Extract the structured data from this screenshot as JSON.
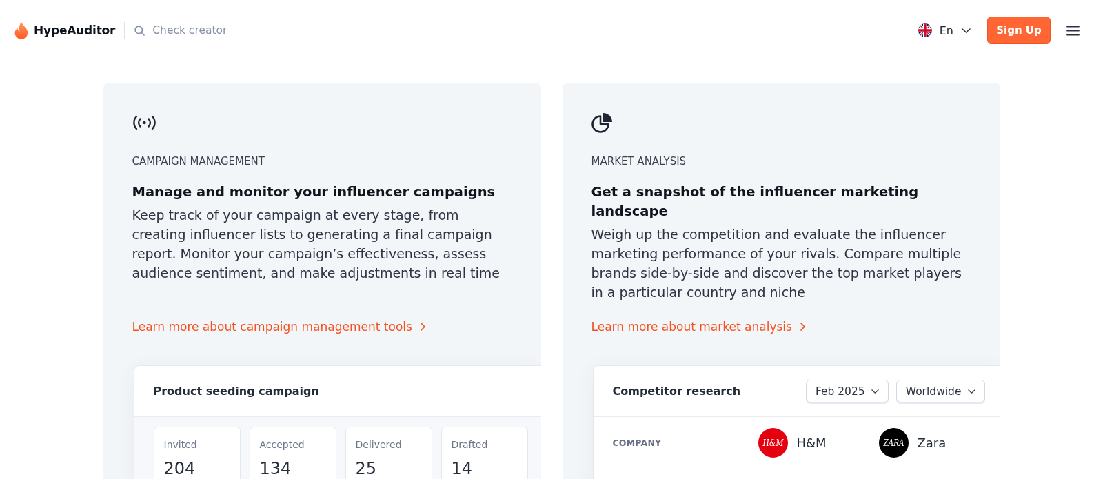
{
  "header": {
    "logo": "HypeAuditor",
    "search": {
      "placeholder": "Check creator"
    },
    "language": "En",
    "signup_button": "Sign Up"
  },
  "cards": [
    {
      "kind": "campaign",
      "label": "CAMPAIGN MANAGEMENT",
      "title": "Manage and monitor your influencer campaigns",
      "description": "Keep track of your campaign at every stage, from creating influencer lists to generating a final campaign report. Monitor your campaign’s effectiveness, assess audience sentiment, and make adjustments in real time",
      "link": "Learn more about campaign management tools",
      "panel": {
        "title": "Product seeding campaign",
        "stats": [
          {
            "label": "Invited",
            "value": "204"
          },
          {
            "label": "Accepted",
            "value": "134"
          },
          {
            "label": "Delivered",
            "value": "25"
          },
          {
            "label": "Drafted",
            "value": "14"
          }
        ]
      }
    },
    {
      "kind": "market",
      "label": "MARKET ANALYSIS",
      "title": "Get a snapshot of the influencer marketing landscape",
      "description": "Weigh up the competition and evaluate the influencer marketing performance of your rivals. Compare multiple brands side-by-side and discover the top market players in a particular country and niche",
      "link": "Learn more about market analysis",
      "panel": {
        "title": "Competitor research",
        "filters": [
          "Feb 2025",
          "Worldwide"
        ],
        "table": {
          "header": "COMPANY",
          "companies": [
            {
              "name": "H&M",
              "logo_text": "H&M",
              "color": "#e50010"
            },
            {
              "name": "Zara",
              "logo_text": "ZARA",
              "color": "#000000"
            }
          ]
        }
      }
    }
  ]
}
